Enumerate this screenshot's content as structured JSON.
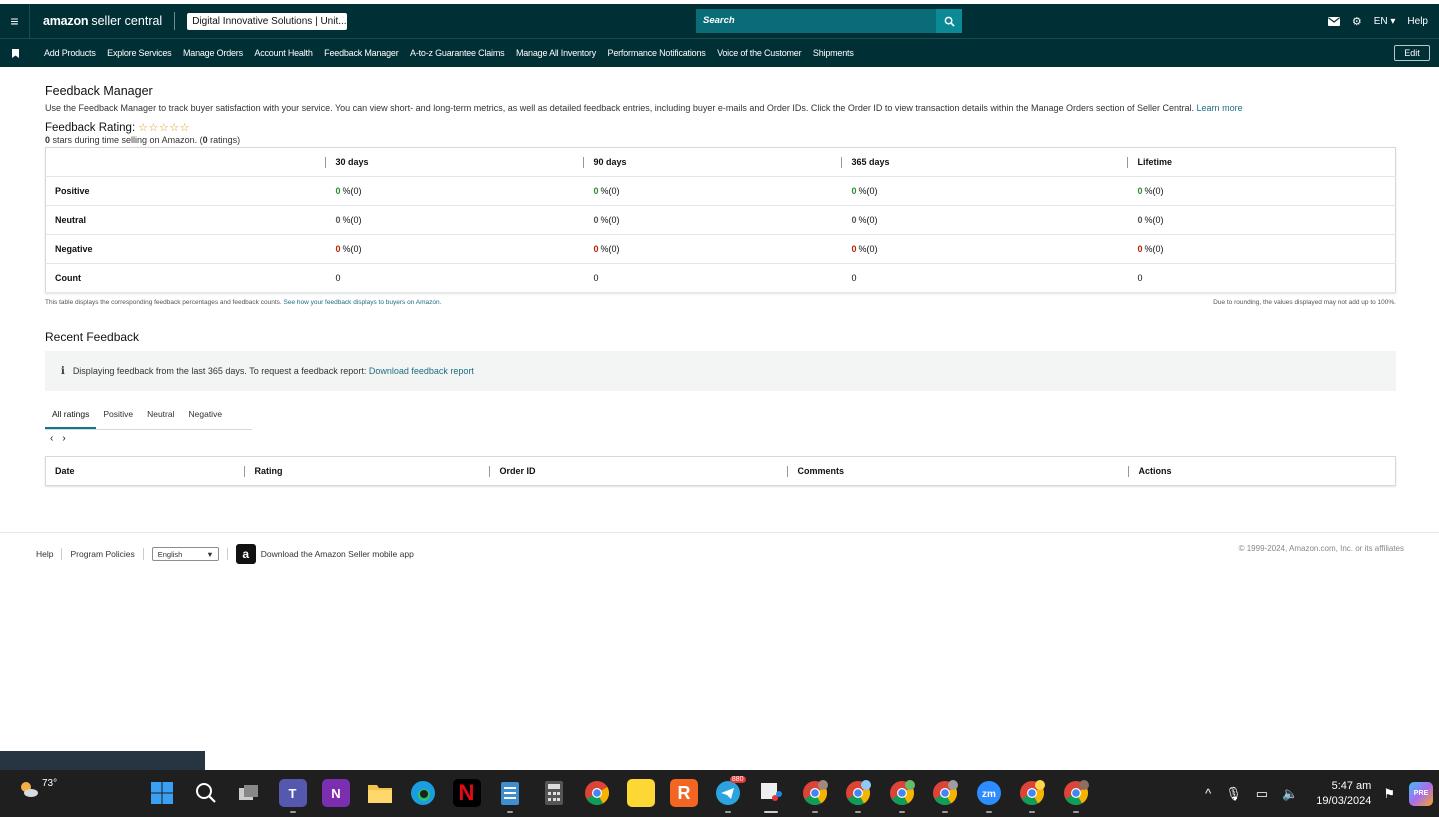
{
  "topbar": {
    "logo_bold": "amazon",
    "logo_rest": "seller central",
    "account": "Digital Innovative Solutions | Unit...",
    "search_placeholder": "Search",
    "language": "EN ▾",
    "help": "Help"
  },
  "nav": {
    "links": [
      "Add Products",
      "Explore Services",
      "Manage Orders",
      "Account Health",
      "Feedback Manager",
      "A-to-z Guarantee Claims",
      "Manage All Inventory",
      "Performance Notifications",
      "Voice of the Customer",
      "Shipments"
    ],
    "edit": "Edit"
  },
  "page": {
    "title": "Feedback Manager",
    "description": "Use the Feedback Manager to track buyer satisfaction with your service. You can view short- and long-term metrics, as well as detailed feedback entries, including buyer e-mails and Order IDs. Click the Order ID to view transaction details within the Manage Orders section of Seller Central.",
    "learn_more": "Learn more",
    "rating_label": "Feedback Rating:",
    "stars": "☆☆☆☆☆",
    "stars_count": "0",
    "stars_note_mid": " stars during time selling on Amazon. (",
    "ratings_count": "0",
    "stars_note_end": " ratings)"
  },
  "feedback_table": {
    "headers": [
      "30 days",
      "90 days",
      "365 days",
      "Lifetime"
    ],
    "rows": [
      {
        "label": "Positive",
        "values": [
          "0",
          "0",
          "0",
          "0"
        ],
        "suffix": "%(0)"
      },
      {
        "label": "Neutral",
        "values": [
          "0",
          "0",
          "0",
          "0"
        ],
        "suffix": "%(0)"
      },
      {
        "label": "Negative",
        "values": [
          "0",
          "0",
          "0",
          "0"
        ],
        "suffix": "%(0)"
      },
      {
        "label": "Count",
        "values": [
          "0",
          "0",
          "0",
          "0"
        ],
        "suffix": ""
      }
    ],
    "note_left": "This table displays the corresponding feedback percentages and feedback counts.",
    "note_link": "See how your feedback displays to buyers on Amazon.",
    "note_right": "Due to rounding, the values displayed may not add up to 100%."
  },
  "recent": {
    "title": "Recent Feedback",
    "info": "Displaying feedback from the last 365 days. To request a feedback report:",
    "info_link": "Download feedback report",
    "tabs": [
      "All ratings",
      "Positive",
      "Neutral",
      "Negative"
    ],
    "columns": [
      "Date",
      "Rating",
      "Order ID",
      "Comments",
      "Actions"
    ]
  },
  "footer": {
    "help": "Help",
    "policies": "Program Policies",
    "language": "English",
    "app": "Download the Amazon Seller mobile app",
    "copyright": "© 1999-2024, Amazon.com, Inc. or its affiliates"
  },
  "taskbar": {
    "temperature": "73°",
    "telegram_badge": "880",
    "time": "5:47 am",
    "date": "19/03/2024"
  },
  "colors": {
    "header_bg": "#002f36",
    "link": "#1e6e80",
    "positive": "#2e8b2e",
    "negative": "#b12704"
  }
}
